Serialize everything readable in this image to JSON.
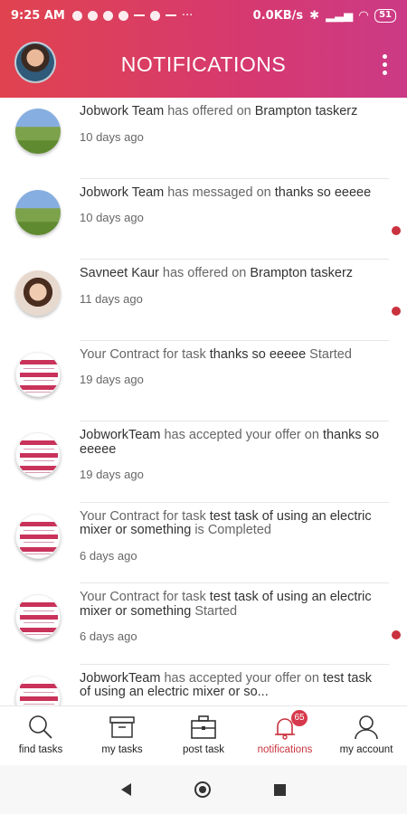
{
  "status": {
    "time": "9:25 AM",
    "speed": "0.0KB/s",
    "battery": "51"
  },
  "header": {
    "title": "NOTIFICATIONS"
  },
  "notifications": [
    {
      "pre": "",
      "bold1": "Jobwork Team",
      "mid": " has offered on ",
      "bold2": "Brampton taskerz",
      "post": "",
      "ago": "10 days ago",
      "avatar": "landscape",
      "unread": false
    },
    {
      "pre": "",
      "bold1": "Jobwork Team",
      "mid": " has messaged on ",
      "bold2": "thanks so eeeee",
      "post": "",
      "ago": "10 days ago",
      "avatar": "landscape",
      "unread": true
    },
    {
      "pre": "",
      "bold1": "Savneet Kaur",
      "mid": " has offered on ",
      "bold2": "Brampton taskerz",
      "post": "",
      "ago": "11 days ago",
      "avatar": "person",
      "unread": true
    },
    {
      "pre": "Your Contract for task ",
      "bold1": "thanks so eeeee",
      "mid": " Started",
      "bold2": "",
      "post": "",
      "ago": "19 days ago",
      "avatar": "contract",
      "unread": false
    },
    {
      "pre": "",
      "bold1": "JobworkTeam",
      "mid": " has accepted your offer on ",
      "bold2": "thanks so eeeee",
      "post": "",
      "ago": "19 days ago",
      "avatar": "contract",
      "unread": false
    },
    {
      "pre": "Your Contract for task ",
      "bold1": "test task of using an electric mixer or something",
      "mid": " is Completed",
      "bold2": "",
      "post": "",
      "ago": "6 days ago",
      "avatar": "contract",
      "unread": false
    },
    {
      "pre": "Your Contract for task ",
      "bold1": "test task of using an electric mixer or something",
      "mid": " Started",
      "bold2": "",
      "post": "",
      "ago": "6 days ago",
      "avatar": "contract",
      "unread": true
    },
    {
      "pre": "",
      "bold1": "JobworkTeam",
      "mid": " has accepted your offer on ",
      "bold2": "test task of using an electric mixer or so...",
      "post": "",
      "ago": "",
      "avatar": "contract",
      "unread": false
    }
  ],
  "tabs": [
    {
      "label": "find tasks",
      "icon": "search-icon",
      "active": false
    },
    {
      "label": "my tasks",
      "icon": "box-icon",
      "active": false
    },
    {
      "label": "post task",
      "icon": "briefcase-icon",
      "active": false
    },
    {
      "label": "notifications",
      "icon": "bell-icon",
      "active": true,
      "badge": "65"
    },
    {
      "label": "my account",
      "icon": "user-icon",
      "active": false
    }
  ],
  "colors": {
    "accent": "#c9323e",
    "header_start": "#e0434f",
    "header_end": "#cc3a86"
  }
}
